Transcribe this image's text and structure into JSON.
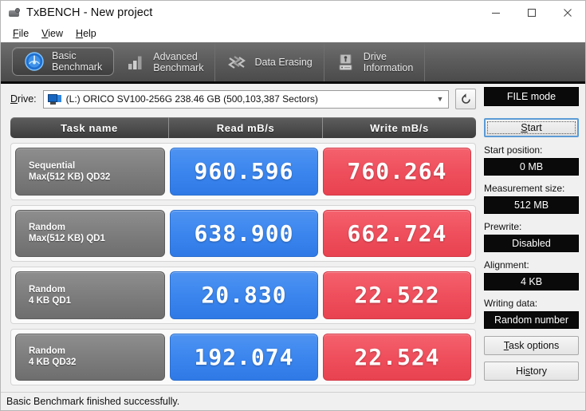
{
  "window": {
    "title": "TxBENCH - New project",
    "icon": "app-icon",
    "controls": {
      "minimize": "—",
      "maximize": "❐",
      "close": "✕"
    }
  },
  "menu": {
    "items": [
      {
        "label": "File",
        "mnemonic": "F",
        "rest": "ile"
      },
      {
        "label": "View",
        "mnemonic": "V",
        "rest": "iew"
      },
      {
        "label": "Help",
        "mnemonic": "H",
        "rest": "elp"
      }
    ]
  },
  "tabs": [
    {
      "label": "Basic\nBenchmark",
      "icon": "gauge-icon",
      "active": true
    },
    {
      "label": "Advanced\nBenchmark",
      "icon": "bar-chart-icon",
      "active": false
    },
    {
      "label": "Data Erasing",
      "icon": "shredder-icon",
      "active": false
    },
    {
      "label": "Drive\nInformation",
      "icon": "hard-drive-icon",
      "active": false
    }
  ],
  "drive": {
    "label": "Drive:",
    "value": "(L:) ORICO SV100-256G  238.46 GB (500,103,387 Sectors)",
    "refresh_icon": "refresh-icon"
  },
  "results": {
    "headers": {
      "task": "Task name",
      "read": "Read mB/s",
      "write": "Write mB/s"
    },
    "rows": [
      {
        "task_line1": "Sequential",
        "task_line2": "Max(512 KB) QD32",
        "read": "960.596",
        "write": "760.264"
      },
      {
        "task_line1": "Random",
        "task_line2": "Max(512 KB) QD1",
        "read": "638.900",
        "write": "662.724"
      },
      {
        "task_line1": "Random",
        "task_line2": "4 KB QD1",
        "read": "20.830",
        "write": "22.522"
      },
      {
        "task_line1": "Random",
        "task_line2": "4 KB QD32",
        "read": "192.074",
        "write": "22.524"
      }
    ]
  },
  "sidebar": {
    "mode": "FILE mode",
    "start": {
      "mnemonic": "S",
      "rest": "tart"
    },
    "start_position": {
      "label": "Start position:",
      "value": "0 MB"
    },
    "measurement_size": {
      "label": "Measurement size:",
      "value": "512 MB"
    },
    "prewrite": {
      "label": "Prewrite:",
      "value": "Disabled"
    },
    "alignment": {
      "label": "Alignment:",
      "value": "4 KB"
    },
    "writing_data": {
      "label": "Writing data:",
      "value": "Random number"
    },
    "task_options": {
      "mnemonic": "T",
      "rest": "ask options"
    },
    "history": {
      "pre": "Hi",
      "mnemonic": "s",
      "rest": "tory"
    }
  },
  "status": {
    "text": "Basic Benchmark finished successfully."
  },
  "colors": {
    "read_accent": "#3b86ee",
    "write_accent": "#ef4f5c",
    "toolbar_dark": "#5d5d5d",
    "field_black": "#0a0a0a",
    "focus_blue": "#5b9bd5"
  }
}
